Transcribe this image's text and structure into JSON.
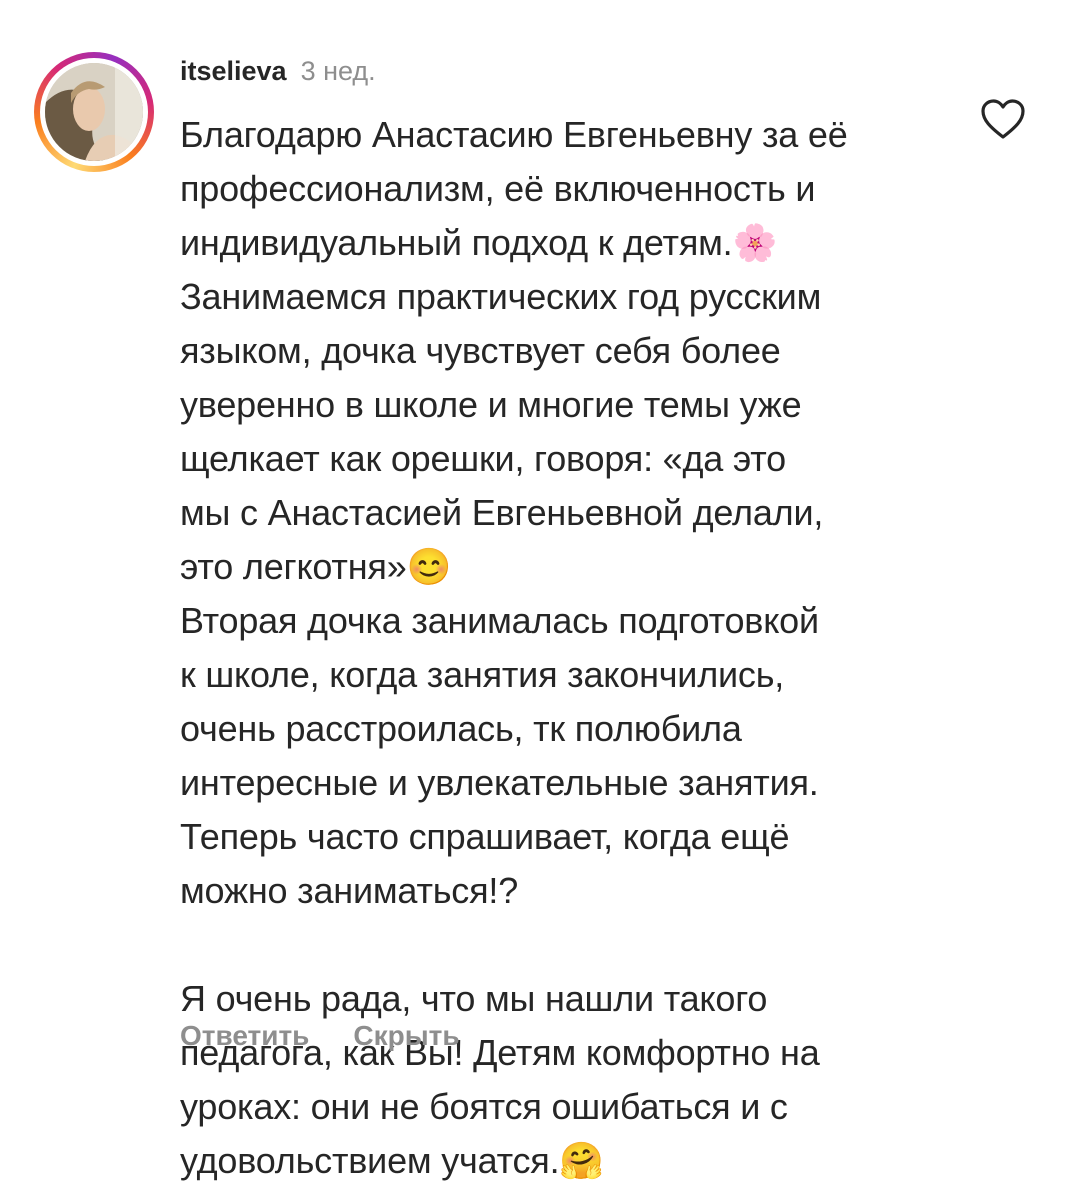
{
  "comment": {
    "username": "itselieva",
    "time_ago": "3 нед.",
    "text": "Благодарю Анастасию Евгеньевну за её\nпрофессионализм, её включенность и\nиндивидуальный подход к детям.🌸\nЗанимаемся практических год русским\nязыком, дочка чувствует себя более\nуверенно в школе и многие темы уже\nщелкает как орешки, говоря: «да это\nмы с Анастасией Евгеньевной делали,\nэто легкотня»😊\nВторая дочка занималась подготовкой\nк школе, когда занятия закончились,\nочень расстроилась, тк полюбила\nинтересные и увлекательные занятия.\nТеперь часто спрашивает, когда ещё\nможно заниматься!?\n\nЯ очень рада, что мы нашли такого\nпедагога, как Вы! Детям комфортно на\nуроках: они не боятся ошибаться и с\nудовольствием учатся.🤗",
    "like_icon": "heart-outline-icon",
    "actions": {
      "reply": "Ответить",
      "hide": "Скрыть"
    }
  },
  "colors": {
    "text": "#262626",
    "secondary": "#8e8e8e",
    "story_ring": [
      "#feda75",
      "#fa7e1e",
      "#d62976",
      "#962fbf"
    ]
  }
}
